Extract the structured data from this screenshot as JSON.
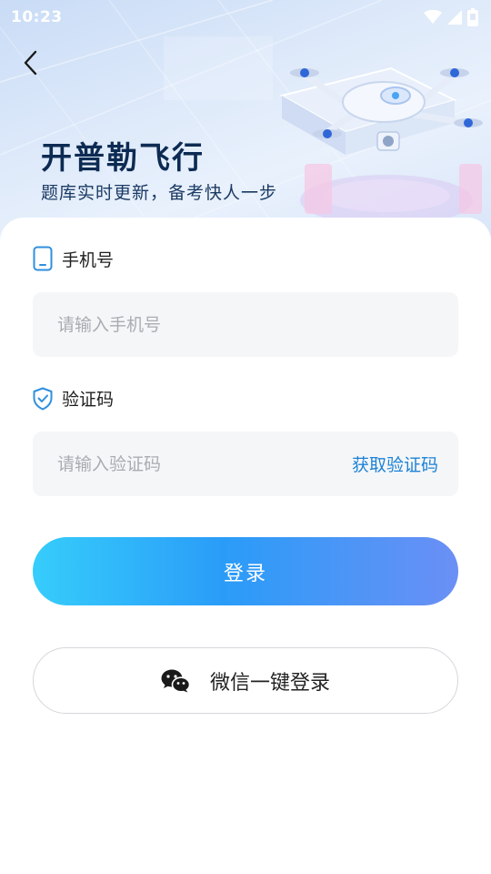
{
  "status_bar": {
    "time": "10:23"
  },
  "hero": {
    "title": "开普勒飞行",
    "subtitle": "题库实时更新，备考快人一步"
  },
  "form": {
    "phone": {
      "label": "手机号",
      "placeholder": "请输入手机号",
      "value": ""
    },
    "code": {
      "label": "验证码",
      "placeholder": "请输入验证码",
      "value": "",
      "get_code_label": "获取验证码"
    },
    "login_label": "登录",
    "wechat_login_label": "微信一键登录"
  },
  "colors": {
    "accent_blue": "#1c82d6",
    "title_navy": "#0d2b52",
    "button_gradient_start": "#36cdfb",
    "button_gradient_end": "#6b8ff5"
  },
  "icons": {
    "back": "chevron-left-icon",
    "phone": "phone-icon",
    "code": "shield-check-icon",
    "wechat": "wechat-icon",
    "wifi": "wifi-icon",
    "signal": "signal-icon",
    "battery": "battery-icon"
  }
}
